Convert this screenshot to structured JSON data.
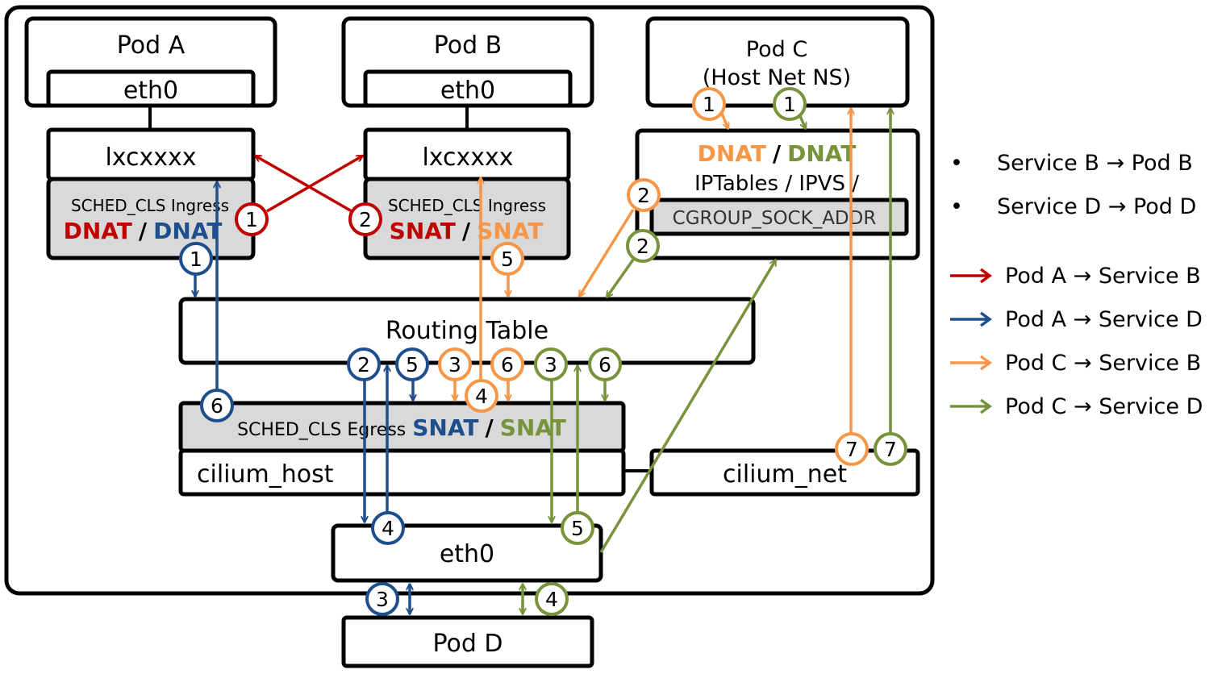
{
  "colors": {
    "red": "#c00000",
    "blue": "#1f4e8c",
    "orange": "#f79646",
    "green": "#77933c",
    "gray_fill": "#d9d9d9",
    "black": "#000000"
  },
  "nodes": {
    "pod_a": {
      "title": "Pod A",
      "eth": "eth0",
      "lxc": "lxcxxxx",
      "hook": "SCHED_CLS Ingress",
      "nat_left": "DNAT",
      "nat_sep": "/",
      "nat_right": "DNAT"
    },
    "pod_b": {
      "title": "Pod B",
      "eth": "eth0",
      "lxc": "lxcxxxx",
      "hook": "SCHED_CLS Ingress",
      "nat_left": "SNAT",
      "nat_sep": "/",
      "nat_right": "SNAT"
    },
    "pod_c": {
      "title_line1": "Pod C",
      "title_line2": "(Host Net NS)"
    },
    "kube_proxy": {
      "nat_left": "DNAT",
      "nat_sep": "/",
      "nat_right": "DNAT",
      "line2": "IPTables / IPVS /",
      "hook": "CGROUP_SOCK_ADDR"
    },
    "routing_table": {
      "label": "Routing Table"
    },
    "egress": {
      "hook": "SCHED_CLS Egress",
      "nat_left": "SNAT",
      "nat_sep": "/",
      "nat_right": "SNAT"
    },
    "cilium_host": {
      "label": "cilium_host"
    },
    "cilium_net": {
      "label": "cilium_net"
    },
    "host_eth0": {
      "label": "eth0"
    },
    "pod_d": {
      "title": "Pod D"
    }
  },
  "steps": {
    "red": [
      "1",
      "2"
    ],
    "blue": [
      "1",
      "2",
      "3",
      "4",
      "5",
      "6"
    ],
    "orange": [
      "1",
      "2",
      "3",
      "4",
      "5",
      "7"
    ],
    "orange_extra": [
      "6"
    ],
    "green": [
      "1",
      "2",
      "3",
      "4",
      "5",
      "6",
      "7"
    ]
  },
  "legend": {
    "notes": [
      {
        "bullet": "•",
        "text": "Service B → Pod B"
      },
      {
        "bullet": "•",
        "text": "Service D → Pod D"
      }
    ],
    "flows": [
      {
        "color": "#c00000",
        "text": "Pod A → Service B"
      },
      {
        "color": "#1f4e8c",
        "text": "Pod A → Service D"
      },
      {
        "color": "#f79646",
        "text": "Pod C → Service B"
      },
      {
        "color": "#77933c",
        "text": "Pod C → Service D"
      }
    ]
  }
}
